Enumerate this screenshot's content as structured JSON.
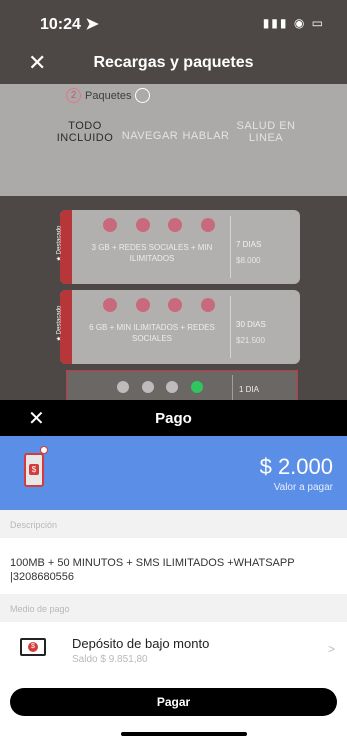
{
  "status": {
    "time": "10:24 ➤",
    "icons": "▮▮▮ ◉ ▭"
  },
  "header": {
    "close": "✕",
    "title": "Recargas y paquetes"
  },
  "stepper": {
    "step_number": "2",
    "label": "Paquetes"
  },
  "tabs": [
    {
      "label": "TODO\nINCLUIDO"
    },
    {
      "label": "NAVEGAR"
    },
    {
      "label": "HABLAR"
    },
    {
      "label": "SALUD EN\nLINEA"
    }
  ],
  "packages": [
    {
      "ribbon": "★ Destacado",
      "description": "3 GB + REDES SOCIALES + MIN ILIMITADOS",
      "days": "7 DIAS",
      "price": "$8.000"
    },
    {
      "ribbon": "★ Destacado",
      "description": "6 GB + MIN ILIMITADOS + REDES SOCIALES",
      "days": "30 DIAS",
      "price": "$21.500"
    },
    {
      "days": "1 DIA"
    }
  ],
  "modal": {
    "close": "✕",
    "title": "Pago",
    "amount": "$ 2.000",
    "amount_label": "Valor a pagar",
    "description_header": "Descripción",
    "description": "100MB + 50 MINUTOS + SMS ILIMITADOS +WHATSAPP |3208680556",
    "method_header": "Medio de pago",
    "method_name": "Depósito de bajo monto",
    "method_balance": "Saldo $ 9.851,80",
    "chevron": ">",
    "pay_button": "Pagar"
  },
  "colors": {
    "accent_blue": "#5b8ee6",
    "ribbon_red": "#b6363a",
    "dark": "#000000"
  }
}
